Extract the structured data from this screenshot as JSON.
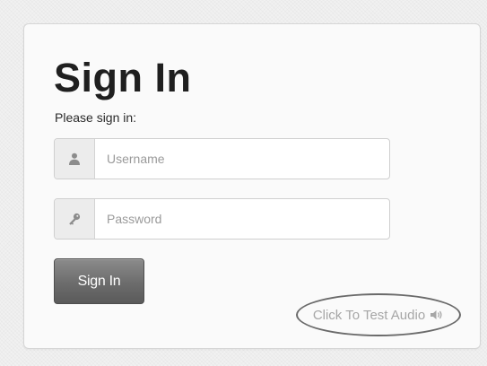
{
  "signin": {
    "title": "Sign In",
    "subtitle": "Please sign in:",
    "username_placeholder": "Username",
    "password_placeholder": "Password",
    "submit_label": "Sign In",
    "audio_link_label": "Click To Test Audio"
  },
  "icons": {
    "username": "user-icon",
    "password": "key-icon",
    "audio": "speaker-icon"
  }
}
